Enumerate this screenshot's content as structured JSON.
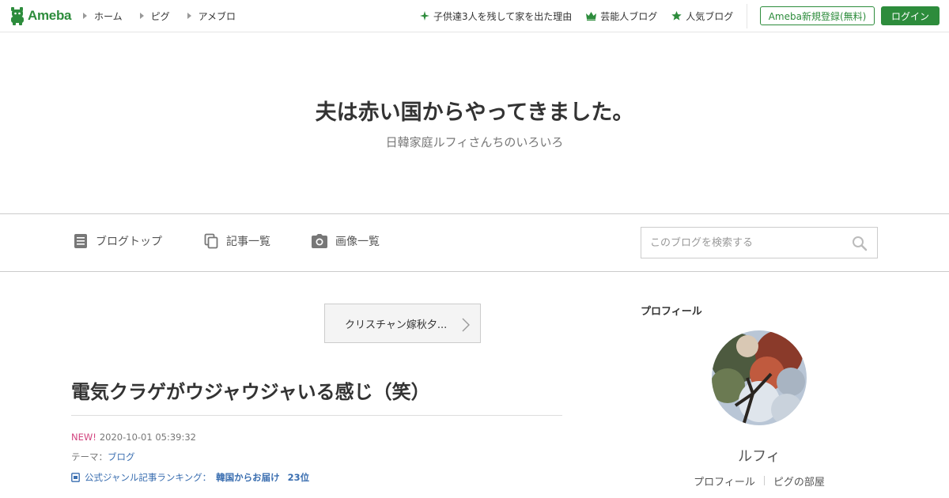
{
  "header": {
    "logo_text": "Ameba",
    "nav": [
      {
        "label": "ホーム"
      },
      {
        "label": "ピグ"
      },
      {
        "label": "アメブロ"
      }
    ],
    "links": [
      {
        "label": "子供達3人を残して家を出た理由",
        "icon": "sparkle-icon"
      },
      {
        "label": "芸能人ブログ",
        "icon": "crown-icon"
      },
      {
        "label": "人気ブログ",
        "icon": "star-icon"
      }
    ],
    "register_label": "Ameba新規登録(無料)",
    "login_label": "ログイン",
    "brand_color": "#2d8c3c"
  },
  "blog": {
    "title": "夫は赤い国からやってきました。",
    "subtitle": "日韓家庭ルフィさんちのいろいろ"
  },
  "blog_nav": {
    "items": [
      {
        "label": "ブログトップ",
        "icon": "document-icon"
      },
      {
        "label": "記事一覧",
        "icon": "copy-icon"
      },
      {
        "label": "画像一覧",
        "icon": "camera-icon"
      }
    ],
    "search_placeholder": "このブログを検索する"
  },
  "main": {
    "prev_entry_label": "クリスチャン嫁秋夕...",
    "article": {
      "title": "電気クラゲがウジャウジャいる感じ（笑）",
      "new_badge": "NEW!",
      "datetime": "2020-10-01 05:39:32",
      "theme_label": "テーマ：",
      "theme_value": "ブログ",
      "ranking_label": "公式ジャンル記事ランキング：",
      "ranking_genre": "韓国からお届け",
      "ranking_position": "23位"
    }
  },
  "sidebar": {
    "heading": "プロフィール",
    "name": "ルフィ",
    "links": [
      {
        "label": "プロフィール"
      },
      {
        "label": "ピグの部屋"
      }
    ]
  }
}
